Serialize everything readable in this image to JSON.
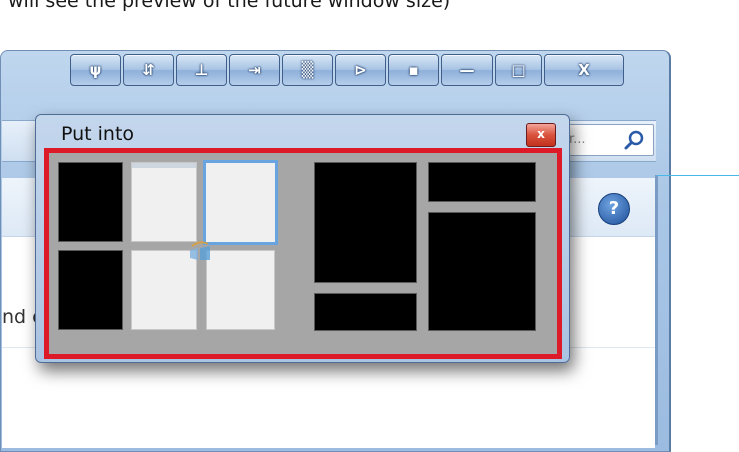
{
  "top_caption": "will see the preview of the future window size)",
  "caption_buttons": [
    {
      "name": "pin-button",
      "label": "ψ"
    },
    {
      "name": "rollup-button",
      "label": "⇵"
    },
    {
      "name": "tile-button",
      "label": "⊥"
    },
    {
      "name": "move-to-monitor-button",
      "label": "⇥"
    },
    {
      "name": "transparency-button",
      "label": "▒"
    },
    {
      "name": "aero-snap-button",
      "label": "⊳"
    },
    {
      "name": "minimize-to-tray-button",
      "label": "▪"
    },
    {
      "name": "minimize-button",
      "label": "—"
    },
    {
      "name": "maximize-button",
      "label": "□"
    },
    {
      "name": "close-button",
      "label": "X"
    }
  ],
  "search": {
    "placeholder": "r..."
  },
  "help_icon": "?",
  "partial_text": "nd c",
  "dialog": {
    "title": "Put into",
    "close_label": "x"
  },
  "colors": {
    "grid_border": "#dd1a28",
    "grid_background": "#a6a6a6",
    "hover_border": "#68a4e0"
  }
}
